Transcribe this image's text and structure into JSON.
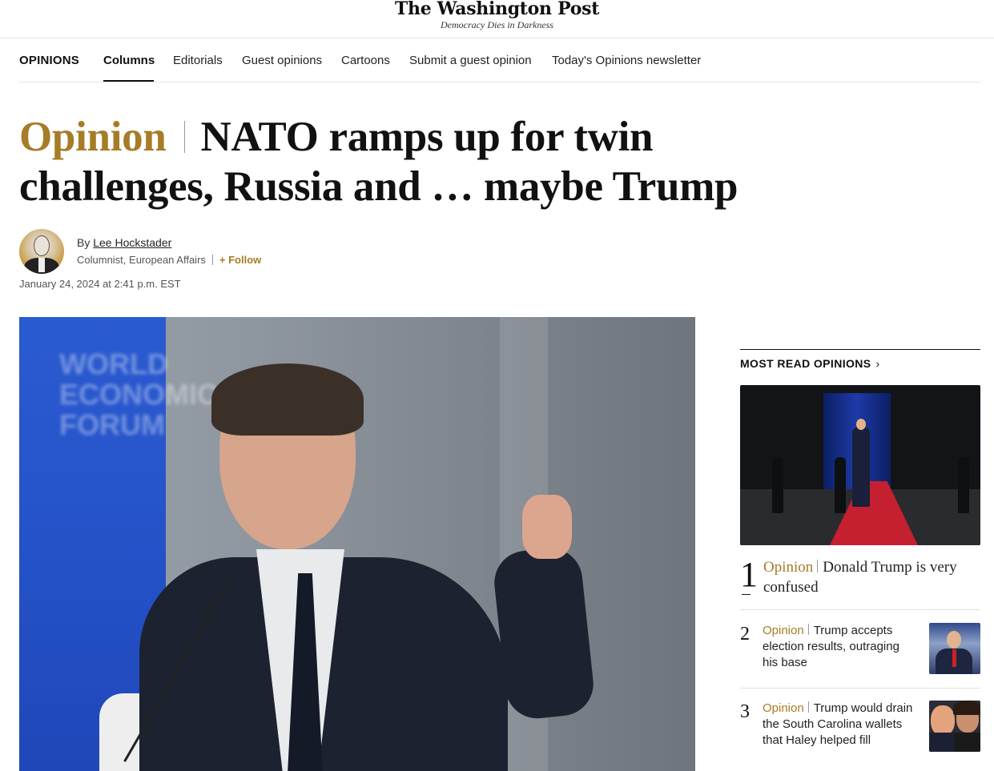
{
  "masthead": {
    "logo": "The Washington Post",
    "tagline": "Democracy Dies in Darkness"
  },
  "nav": {
    "section": "OPINIONS",
    "items": [
      {
        "label": "Columns",
        "active": true
      },
      {
        "label": "Editorials"
      },
      {
        "label": "Guest opinions"
      },
      {
        "label": "Cartoons"
      },
      {
        "label": "Submit a guest opinion"
      },
      {
        "label": "Today's Opinions newsletter"
      }
    ]
  },
  "article": {
    "kicker": "Opinion",
    "title": "NATO ramps up for twin challenges, Russia and … maybe Trump",
    "byline_prefix": "By",
    "author": "Lee Hockstader",
    "role": "Columnist, European Affairs",
    "follow_label": "+ Follow",
    "timestamp": "January 24, 2024 at 2:41 p.m. EST"
  },
  "hero": {
    "banner_text": "WORLD ECONOMIC FORUM"
  },
  "most_read": {
    "heading": "MOST READ OPINIONS",
    "chevron": "›",
    "items": [
      {
        "rank": "1",
        "kicker": "Opinion",
        "title": "Donald Trump is very confused"
      },
      {
        "rank": "2",
        "kicker": "Opinion",
        "title": "Trump accepts election results, outraging his base"
      },
      {
        "rank": "3",
        "kicker": "Opinion",
        "title": "Trump would drain the South Carolina wallets that Haley helped fill"
      }
    ]
  },
  "colors": {
    "opinion_gold": "#a67c26",
    "text": "#111111"
  }
}
